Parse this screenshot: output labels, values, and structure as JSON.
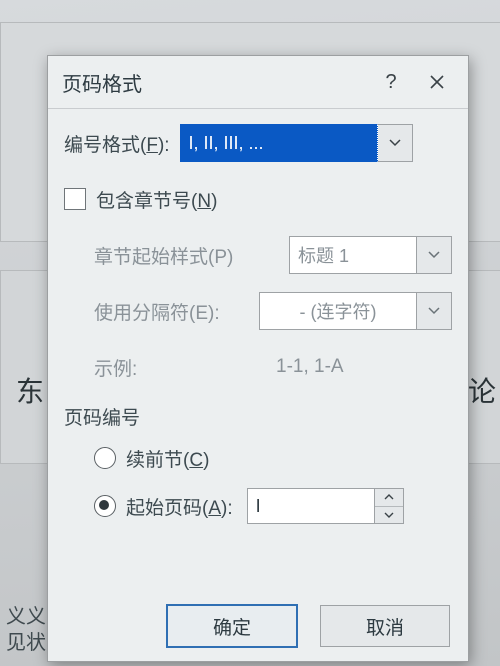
{
  "bg": {
    "left_text": "东",
    "right_text": "毕业论",
    "bottom_line1": "义义.",
    "bottom_line2": "见状"
  },
  "dialog": {
    "title": "页码格式",
    "format_label_pre": "编号格式(",
    "format_label_key": "F",
    "format_label_post": "):",
    "format_value": "I, II, III, ...",
    "include_chapter_pre": "包含章节号(",
    "include_chapter_key": "N",
    "include_chapter_post": ")",
    "chapter_start_label": "章节起始样式(P)",
    "chapter_start_value": "标题 1",
    "separator_label": "使用分隔符(E):",
    "separator_value": "-  (连字符)",
    "example_label": "示例:",
    "example_value": "1-1, 1-A",
    "numbering_title": "页码编号",
    "continue_label_pre": "续前节(",
    "continue_label_key": "C",
    "continue_label_post": ")",
    "start_at_pre": "起始页码(",
    "start_at_key": "A",
    "start_at_post": "):",
    "start_at_value": "I",
    "ok": "确定",
    "cancel": "取消"
  }
}
